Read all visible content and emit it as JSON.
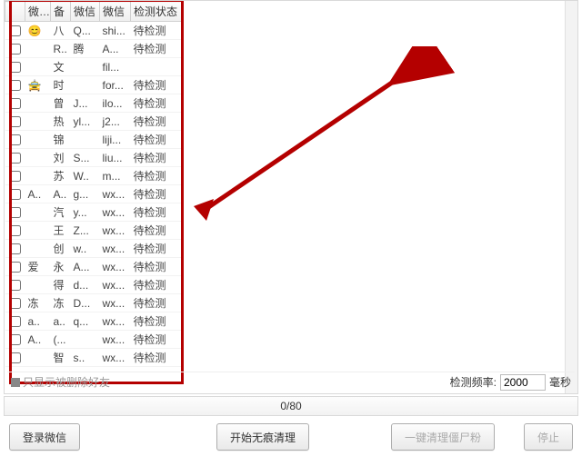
{
  "table": {
    "headers": [
      "",
      "微信",
      "备",
      "微信",
      "微信",
      "检测状态"
    ],
    "rows": [
      {
        "c2": "😊",
        "c3": "八",
        "c4": "Q...",
        "c5": "shi...",
        "c6": "待检测"
      },
      {
        "c2": "",
        "c3": "R..",
        "c4": "腾",
        "c5": "A...",
        "c6": "待检测"
      },
      {
        "c2": "",
        "c3": "文",
        "c4": "",
        "c5": "fil...",
        "c6": ""
      },
      {
        "c2": "🚖",
        "c3": "时",
        "c4": "",
        "c5": "for...",
        "c6": "待检测"
      },
      {
        "c2": "",
        "c3": "曾",
        "c4": "J...",
        "c5": "ilo...",
        "c6": "待检测"
      },
      {
        "c2": "",
        "c3": "热",
        "c4": "yl...",
        "c5": "j2...",
        "c6": "待检测"
      },
      {
        "c2": "",
        "c3": "锦",
        "c4": "",
        "c5": "liji...",
        "c6": "待检测"
      },
      {
        "c2": "",
        "c3": "刘",
        "c4": "S...",
        "c5": "liu...",
        "c6": "待检测"
      },
      {
        "c2": "",
        "c3": "苏",
        "c4": "W..",
        "c5": "m...",
        "c6": "待检测"
      },
      {
        "c2": "A..",
        "c3": "A..",
        "c4": "g...",
        "c5": "wx...",
        "c6": "待检测"
      },
      {
        "c2": "",
        "c3": "汽",
        "c4": "y...",
        "c5": "wx...",
        "c6": "待检测"
      },
      {
        "c2": "",
        "c3": "王",
        "c4": "Z...",
        "c5": "wx...",
        "c6": "待检测"
      },
      {
        "c2": "",
        "c3": "创",
        "c4": "w..",
        "c5": "wx...",
        "c6": "待检测"
      },
      {
        "c2": "爱",
        "c3": "永",
        "c4": "A...",
        "c5": "wx...",
        "c6": "待检测"
      },
      {
        "c2": "",
        "c3": "得",
        "c4": "d...",
        "c5": "wx...",
        "c6": "待检测"
      },
      {
        "c2": "冻",
        "c3": "冻",
        "c4": "D...",
        "c5": "wx...",
        "c6": "待检测"
      },
      {
        "c2": "a..",
        "c3": "a..",
        "c4": "q...",
        "c5": "wx...",
        "c6": "待检测"
      },
      {
        "c2": "A..",
        "c3": "(...",
        "c4": "",
        "c5": "wx...",
        "c6": "待检测"
      },
      {
        "c2": "",
        "c3": "智",
        "c4": "s..",
        "c5": "wx...",
        "c6": "待检测"
      }
    ]
  },
  "deleted_only_label": "只显示被删除好友",
  "freq": {
    "label": "检测频率:",
    "value": "2000",
    "unit": "毫秒"
  },
  "counter": "0/80",
  "buttons": {
    "login": "登录微信",
    "clean": "开始无痕清理",
    "zombie": "一键清理僵尸粉",
    "stop": "停止"
  },
  "annotation": {
    "box_color": "#b40000"
  }
}
